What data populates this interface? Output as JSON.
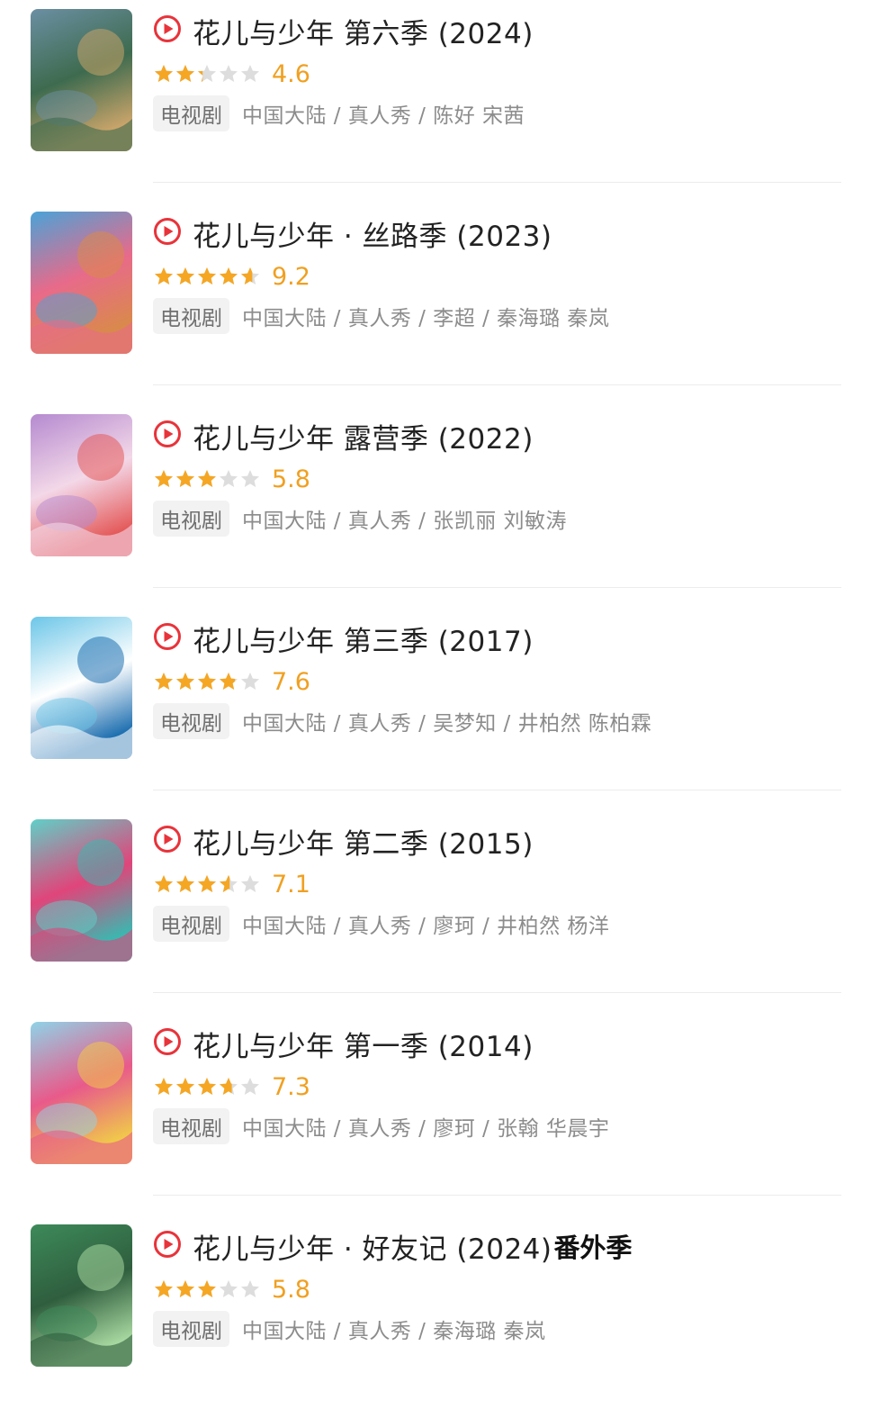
{
  "items": [
    {
      "title": "花儿与少年 第六季  (2024)",
      "suffix": "",
      "rating": 4.6,
      "score": "4.6",
      "tag": "电视剧",
      "meta": "中国大陆 / 真人秀 / 陈好 宋茜",
      "poster_colors": [
        "#6b8fa3",
        "#c9a46a",
        "#3e6b4f"
      ]
    },
    {
      "title": "花儿与少年 · 丝路季  (2023)",
      "suffix": "",
      "rating": 9.2,
      "score": "9.2",
      "tag": "电视剧",
      "meta": "中国大陆 / 真人秀 / 李超 / 秦海璐 秦岚",
      "poster_colors": [
        "#4aa3d8",
        "#d98a4a",
        "#e86a8a"
      ]
    },
    {
      "title": "花儿与少年 露营季  (2022)",
      "suffix": "",
      "rating": 5.8,
      "score": "5.8",
      "tag": "电视剧",
      "meta": "中国大陆 / 真人秀 / 张凯丽 刘敏涛",
      "poster_colors": [
        "#b58ad0",
        "#e45a5a",
        "#f3d8e8"
      ]
    },
    {
      "title": "花儿与少年 第三季  (2017)",
      "suffix": "",
      "rating": 7.6,
      "score": "7.6",
      "tag": "电视剧",
      "meta": "中国大陆 / 真人秀 / 吴梦知 / 井柏然 陈柏霖",
      "poster_colors": [
        "#6cc6e8",
        "#1e6fb0",
        "#ffffff"
      ]
    },
    {
      "title": "花儿与少年 第二季  (2015)",
      "suffix": "",
      "rating": 7.1,
      "score": "7.1",
      "tag": "电视剧",
      "meta": "中国大陆 / 真人秀 / 廖珂 / 井柏然 杨洋",
      "poster_colors": [
        "#5fd0c8",
        "#3ab8b0",
        "#e0457a"
      ]
    },
    {
      "title": "花儿与少年 第一季  (2014)",
      "suffix": "",
      "rating": 7.3,
      "score": "7.3",
      "tag": "电视剧",
      "meta": "中国大陆 / 真人秀 / 廖珂 / 张翰 华晨宇",
      "poster_colors": [
        "#8fd3e8",
        "#f0c94a",
        "#e85a8a"
      ]
    },
    {
      "title": "花儿与少年 · 好友记  (2024)",
      "suffix": "番外季",
      "rating": 5.8,
      "score": "5.8",
      "tag": "电视剧",
      "meta": "中国大陆 / 真人秀 / 秦海璐 秦岚",
      "poster_colors": [
        "#3d8a5a",
        "#a8d8a0",
        "#2f5e3e"
      ]
    }
  ],
  "colors": {
    "star_on": "#f5a623",
    "star_off": "#dddddd",
    "play_icon": "#e8333a",
    "score": "#f0a021"
  }
}
